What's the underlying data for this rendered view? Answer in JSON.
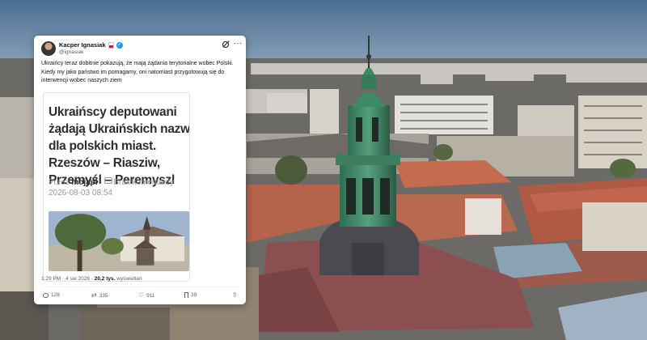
{
  "tweet": {
    "author_name": "Kacper Ignasiak",
    "handle": "@ignasiak",
    "text": "Ukraińcy teraz dobitnie pokazują, że mają żądania terytorialne wobec Polski. Kiedy my jako państwo im pomagamy, oni natomiast przygotowują się do interwencji wobec naszych ziem",
    "timestamp": "1:29 PM · 4 sie 2026 ·",
    "views_count": "20,2 tys.",
    "views_label": "wyświetleń"
  },
  "card": {
    "title": "Ukraińscy deputowani żądają Ukraińskich nazw dla polskich miast. Rzeszów – Riasziw, Przemyśl – Peremyszl",
    "by_label": "Przez",
    "author": "mojapl",
    "comments": "Brak komentarzy",
    "date": "2026-08-03 08:54"
  },
  "actions": {
    "replies": "128",
    "retweets": "335",
    "likes": "911",
    "bookmarks": "39"
  },
  "icons": [
    "verified-icon",
    "flag-icon",
    "grok-icon",
    "more-icon",
    "comment-icon",
    "reply-icon",
    "retweet-icon",
    "like-icon",
    "bookmark-icon",
    "share-icon"
  ],
  "colors": {
    "accent": "#1d9bf0",
    "text": "#0f1419",
    "muted": "#536471"
  }
}
